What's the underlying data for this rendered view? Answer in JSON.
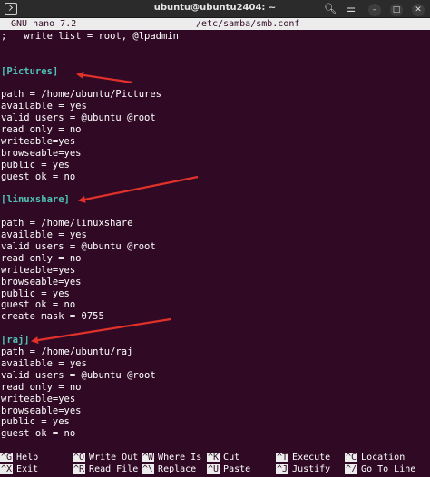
{
  "window": {
    "title": "ubuntu@ubuntu2404: ~",
    "icons": [
      "terminal-icon",
      "search-icon",
      "menu-icon",
      "minimize-icon",
      "maximize-icon",
      "close-icon"
    ]
  },
  "nano": {
    "version": "GNU nano 7.2",
    "filename": "/etc/samba/smb.conf"
  },
  "lines": [
    ";   write list = root, @lpadmin",
    "",
    "",
    "[Pictures]",
    "",
    "path = /home/ubuntu/Pictures",
    "available = yes",
    "valid users = @ubuntu @root",
    "read only = no",
    "writeable=yes",
    "browseable=yes",
    "public = yes",
    "guest ok = no",
    "",
    "[linuxshare]",
    "",
    "path = /home/linuxshare",
    "available = yes",
    "valid users = @ubuntu @root",
    "read only = no",
    "writeable=yes",
    "browseable=yes",
    "public = yes",
    "guest ok = no",
    "create mask = 0755",
    "",
    "[raj]",
    "path = /home/ubuntu/raj",
    "available = yes",
    "valid users = @ubuntu @root",
    "read only = no",
    "writeable=yes",
    "browseable=yes",
    "public = yes",
    "guest ok = no"
  ],
  "shortcuts": [
    {
      "key": "^G",
      "label": "Help"
    },
    {
      "key": "^X",
      "label": "Exit"
    },
    {
      "key": "^O",
      "label": "Write Out"
    },
    {
      "key": "^R",
      "label": "Read File"
    },
    {
      "key": "^W",
      "label": "Where Is"
    },
    {
      "key": "^\\",
      "label": "Replace"
    },
    {
      "key": "^K",
      "label": "Cut"
    },
    {
      "key": "^U",
      "label": "Paste"
    },
    {
      "key": "^T",
      "label": "Execute"
    },
    {
      "key": "^J",
      "label": "Justify"
    },
    {
      "key": "^C",
      "label": "Location"
    },
    {
      "key": "^/",
      "label": "Go To Line"
    }
  ],
  "colors": {
    "background": "#300a24",
    "section_header": "#4fc1b4",
    "arrow": "#e0312b"
  }
}
